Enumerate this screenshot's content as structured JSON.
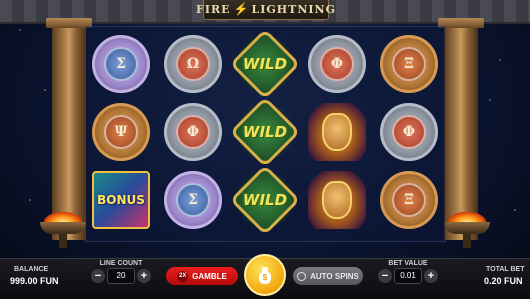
{
  "game": {
    "title_left": "FIRE",
    "title_right": "LIGHTNING"
  },
  "reels": {
    "columns": [
      [
        {
          "type": "purple",
          "glyph": "Σ"
        },
        {
          "type": "bronze",
          "glyph": "Ψ"
        },
        {
          "type": "bonus",
          "label": "BONUS"
        }
      ],
      [
        {
          "type": "silver",
          "glyph": "Ω"
        },
        {
          "type": "silver",
          "glyph": "Φ"
        },
        {
          "type": "purple",
          "glyph": "Σ"
        }
      ],
      [
        {
          "type": "wild",
          "label": "WILD"
        },
        {
          "type": "wild",
          "label": "WILD"
        },
        {
          "type": "wild",
          "label": "WILD"
        }
      ],
      [
        {
          "type": "silver",
          "glyph": "Φ"
        },
        {
          "type": "zeus"
        },
        {
          "type": "zeus"
        }
      ],
      [
        {
          "type": "bronze",
          "glyph": "Ξ"
        },
        {
          "type": "silver",
          "glyph": "Φ"
        },
        {
          "type": "bronze",
          "glyph": "Ξ"
        }
      ]
    ]
  },
  "controls": {
    "balance_label": "BALANCE",
    "balance_value": "999.00 FUN",
    "line_count_label": "LINE COUNT",
    "line_count_value": "20",
    "gamble_label": "GAMBLE",
    "gamble_badge": "2X",
    "spin_icon": "$",
    "auto_spins_label": "AUTO SPINS",
    "bet_value_label": "BET VALUE",
    "bet_value": "0.01",
    "total_bet_label": "TOTAL BET",
    "total_bet_value": "0.20 FUN",
    "minus": "−",
    "plus": "+"
  }
}
